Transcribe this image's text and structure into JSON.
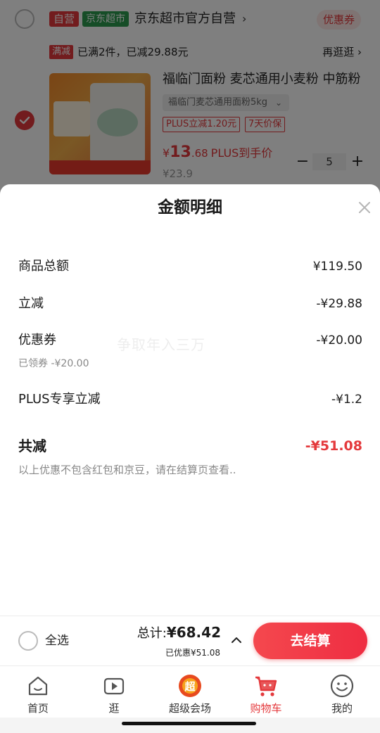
{
  "cart": {
    "shop": {
      "tag_self": "自营",
      "tag_supermarket": "京东超市",
      "name": "京东超市官方自营",
      "chevron": "›",
      "coupon_label": "优惠券"
    },
    "promo": {
      "tag": "满减",
      "text": "已满2件，已减29.88元",
      "more_label": "再逛逛 ›"
    },
    "item": {
      "title": "福临门面粉 麦芯通用小麦粉 中筋粉",
      "spec": "福临门麦芯通用面粉5kg",
      "tags": [
        "PLUS立减1.20元",
        "7天价保"
      ],
      "price_symbol": "¥",
      "price_int": "13",
      "price_dec": ".68",
      "price_suffix": "PLUS到手价",
      "original_price": "¥23.9",
      "quantity": "5",
      "minus": "−",
      "plus": "+"
    }
  },
  "sheet": {
    "title": "金额明细",
    "watermark": "争取年入三万",
    "lines": [
      {
        "label": "商品总额",
        "value": "¥119.50"
      },
      {
        "label": "立减",
        "value": "-¥29.88"
      },
      {
        "label": "优惠券",
        "value": "-¥20.00",
        "sub": "已领券 -¥20.00"
      },
      {
        "label": "PLUS专享立减",
        "value": "-¥1.2"
      }
    ],
    "total_label": "共减",
    "total_value": "-¥51.08",
    "note": "以上优惠不包含红包和京豆，请在结算页查看.."
  },
  "settlement": {
    "select_all": "全选",
    "total_label": "总计:",
    "total_amount": "¥68.42",
    "saved": "已优惠¥51.08",
    "checkout": "去结算"
  },
  "tabs": [
    {
      "label": "首页",
      "icon": "home-icon"
    },
    {
      "label": "逛",
      "icon": "video-play-icon"
    },
    {
      "label": "超级会场",
      "icon": "super-venue-icon"
    },
    {
      "label": "购物车",
      "icon": "cart-icon",
      "active": true
    },
    {
      "label": "我的",
      "icon": "profile-face-icon"
    }
  ],
  "colors": {
    "accent": "#e4393c",
    "supermarket_green": "#2d9a4f",
    "overlay": "rgba(0,0,0,0.5)"
  }
}
